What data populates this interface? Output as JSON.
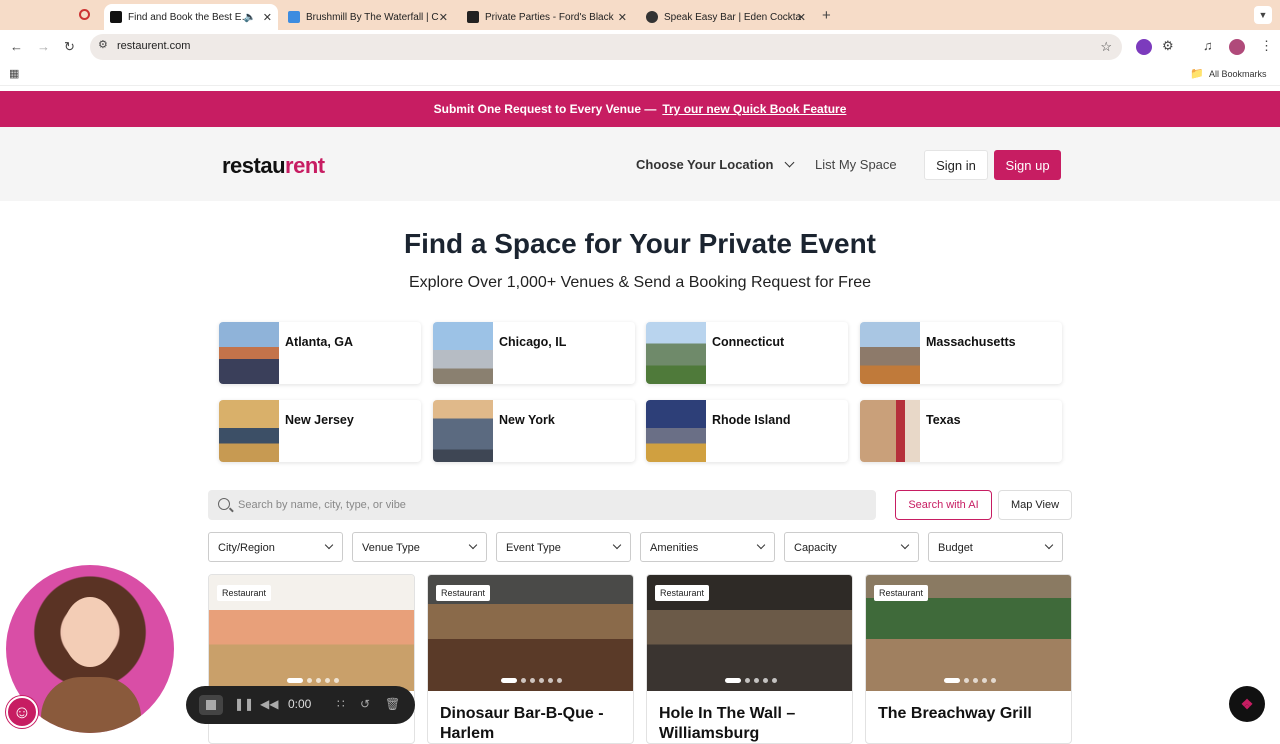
{
  "browser": {
    "tabs": [
      {
        "title": "Find and Book the Best E…",
        "active": true
      },
      {
        "title": "Brushmill By The Waterfall | C",
        "active": false
      },
      {
        "title": "Private Parties - Ford's Black",
        "active": false
      },
      {
        "title": "Speak Easy Bar | Eden Cockta",
        "active": false
      }
    ],
    "url": "restaurent.com",
    "bookmarks_label": "All Bookmarks"
  },
  "banner": {
    "text": "Submit One Request to Every Venue —",
    "link": "Try our new Quick Book Feature"
  },
  "header": {
    "logo_a": "restau",
    "logo_b": "rent",
    "location": "Choose Your Location",
    "list_space": "List My Space",
    "sign_in": "Sign in",
    "sign_up": "Sign up"
  },
  "hero": {
    "title": "Find a Space for Your Private Event",
    "subtitle": "Explore Over 1,000+ Venues & Send a Booking Request for Free"
  },
  "locations": [
    {
      "name": "Atlanta, GA"
    },
    {
      "name": "Chicago, IL"
    },
    {
      "name": "Connecticut"
    },
    {
      "name": "Massachusetts"
    },
    {
      "name": "New Jersey"
    },
    {
      "name": "New York"
    },
    {
      "name": "Rhode Island"
    },
    {
      "name": "Texas"
    }
  ],
  "search": {
    "placeholder": "Search by name, city, type, or vibe",
    "ai_button": "Search with AI",
    "map_button": "Map View"
  },
  "filters": [
    "City/Region",
    "Venue Type",
    "Event Type",
    "Amenities",
    "Capacity",
    "Budget"
  ],
  "venues": [
    {
      "badge": "Restaurant",
      "name": ""
    },
    {
      "badge": "Restaurant",
      "name": "Dinosaur Bar-B-Que - Harlem"
    },
    {
      "badge": "Restaurant",
      "name": "Hole In The Wall – Williamsburg"
    },
    {
      "badge": "Restaurant",
      "name": "The Breachway Grill"
    }
  ],
  "recorder": {
    "time": "0:00"
  },
  "colors": {
    "brand": "#c71d62",
    "tabbar": "#f6dcc8"
  }
}
